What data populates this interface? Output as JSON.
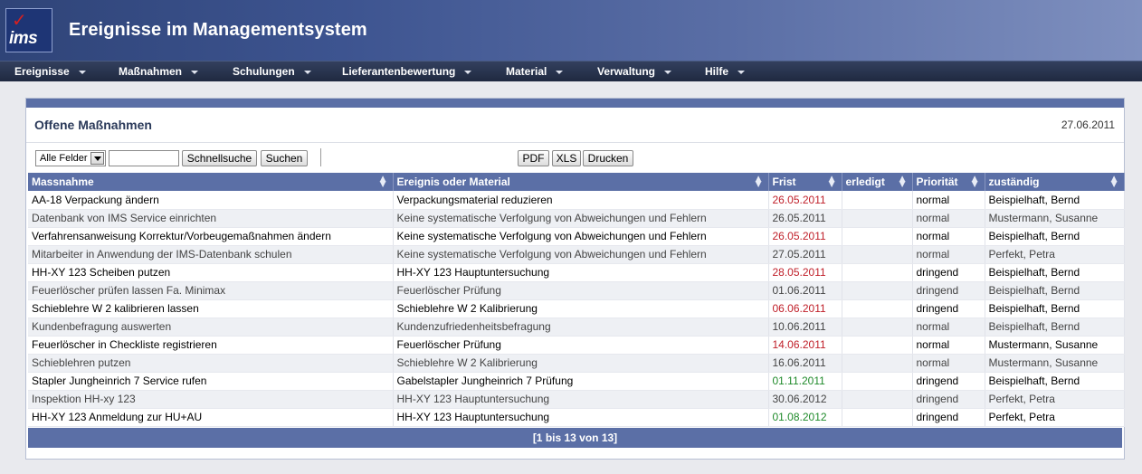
{
  "app": {
    "logo_text": "ims",
    "logo_mark": "✓",
    "title": "Ereignisse im Managementsystem"
  },
  "nav": [
    {
      "label": "Ereignisse"
    },
    {
      "label": "Maßnahmen"
    },
    {
      "label": "Schulungen"
    },
    {
      "label": "Lieferantenbewertung"
    },
    {
      "label": "Material"
    },
    {
      "label": "Verwaltung"
    },
    {
      "label": "Hilfe"
    }
  ],
  "panel": {
    "title": "Offene Maßnahmen",
    "date": "27.06.2011"
  },
  "toolbar": {
    "field_select": "Alle Felder",
    "search_value": "",
    "quick_search": "Schnellsuche",
    "search": "Suchen",
    "pdf": "PDF",
    "xls": "XLS",
    "print": "Drucken"
  },
  "table": {
    "columns": [
      "Massnahme",
      "Ereignis oder Material",
      "Frist",
      "erledigt",
      "Priorität",
      "zuständig"
    ],
    "rows": [
      {
        "massnahme": "AA-18 Verpackung ändern",
        "ereignis": "Verpackungsmaterial reduzieren",
        "frist": "26.05.2011",
        "frist_status": "overdue",
        "erledigt": "",
        "prioritaet": "normal",
        "zustaendig": "Beispielhaft, Bernd"
      },
      {
        "massnahme": "Datenbank von IMS Service einrichten",
        "ereignis": "Keine systematische Verfolgung von Abweichungen und Fehlern",
        "frist": "26.05.2011",
        "frist_status": "overdue",
        "erledigt": "",
        "prioritaet": "normal",
        "zustaendig": "Mustermann, Susanne"
      },
      {
        "massnahme": "Verfahrensanweisung Korrektur/Vorbeugemaßnahmen ändern",
        "ereignis": "Keine systematische Verfolgung von Abweichungen und Fehlern",
        "frist": "26.05.2011",
        "frist_status": "overdue",
        "erledigt": "",
        "prioritaet": "normal",
        "zustaendig": "Beispielhaft, Bernd"
      },
      {
        "massnahme": "Mitarbeiter in Anwendung der IMS-Datenbank schulen",
        "ereignis": "Keine systematische Verfolgung von Abweichungen und Fehlern",
        "frist": "27.05.2011",
        "frist_status": "overdue",
        "erledigt": "",
        "prioritaet": "normal",
        "zustaendig": "Perfekt, Petra"
      },
      {
        "massnahme": "HH-XY 123 Scheiben putzen",
        "ereignis": "HH-XY 123 Hauptuntersuchung",
        "frist": "28.05.2011",
        "frist_status": "overdue",
        "erledigt": "",
        "prioritaet": "dringend",
        "zustaendig": "Beispielhaft, Bernd"
      },
      {
        "massnahme": "Feuerlöscher prüfen lassen Fa. Minimax",
        "ereignis": "Feuerlöscher Prüfung",
        "frist": "01.06.2011",
        "frist_status": "overdue",
        "erledigt": "",
        "prioritaet": "dringend",
        "zustaendig": "Beispielhaft, Bernd"
      },
      {
        "massnahme": "Schieblehre W 2 kalibrieren lassen",
        "ereignis": "Schieblehre W 2 Kalibrierung",
        "frist": "06.06.2011",
        "frist_status": "overdue",
        "erledigt": "",
        "prioritaet": "dringend",
        "zustaendig": "Beispielhaft, Bernd"
      },
      {
        "massnahme": "Kundenbefragung auswerten",
        "ereignis": "Kundenzufriedenheitsbefragung",
        "frist": "10.06.2011",
        "frist_status": "overdue",
        "erledigt": "",
        "prioritaet": "normal",
        "zustaendig": "Beispielhaft, Bernd"
      },
      {
        "massnahme": "Feuerlöscher in Checkliste registrieren",
        "ereignis": "Feuerlöscher Prüfung",
        "frist": "14.06.2011",
        "frist_status": "overdue",
        "erledigt": "",
        "prioritaet": "normal",
        "zustaendig": "Mustermann, Susanne"
      },
      {
        "massnahme": "Schieblehren putzen",
        "ereignis": "Schieblehre W 2 Kalibrierung",
        "frist": "16.06.2011",
        "frist_status": "overdue",
        "erledigt": "",
        "prioritaet": "normal",
        "zustaendig": "Mustermann, Susanne"
      },
      {
        "massnahme": "Stapler Jungheinrich 7 Service rufen",
        "ereignis": "Gabelstapler Jungheinrich 7 Prüfung",
        "frist": "01.11.2011",
        "frist_status": "open",
        "erledigt": "",
        "prioritaet": "dringend",
        "zustaendig": "Beispielhaft, Bernd"
      },
      {
        "massnahme": "Inspektion HH-xy 123",
        "ereignis": "HH-XY 123 Hauptuntersuchung",
        "frist": "30.06.2012",
        "frist_status": "open",
        "erledigt": "",
        "prioritaet": "dringend",
        "zustaendig": "Perfekt, Petra"
      },
      {
        "massnahme": "HH-XY 123 Anmeldung zur HU+AU",
        "ereignis": "HH-XY 123 Hauptuntersuchung",
        "frist": "01.08.2012",
        "frist_status": "open",
        "erledigt": "",
        "prioritaet": "dringend",
        "zustaendig": "Perfekt, Petra"
      }
    ],
    "pagination": "[1 bis 13 von 13]"
  },
  "colors": {
    "header_blue": "#5b6fa6",
    "overdue": "#c0202a",
    "open": "#1f8a2a"
  }
}
